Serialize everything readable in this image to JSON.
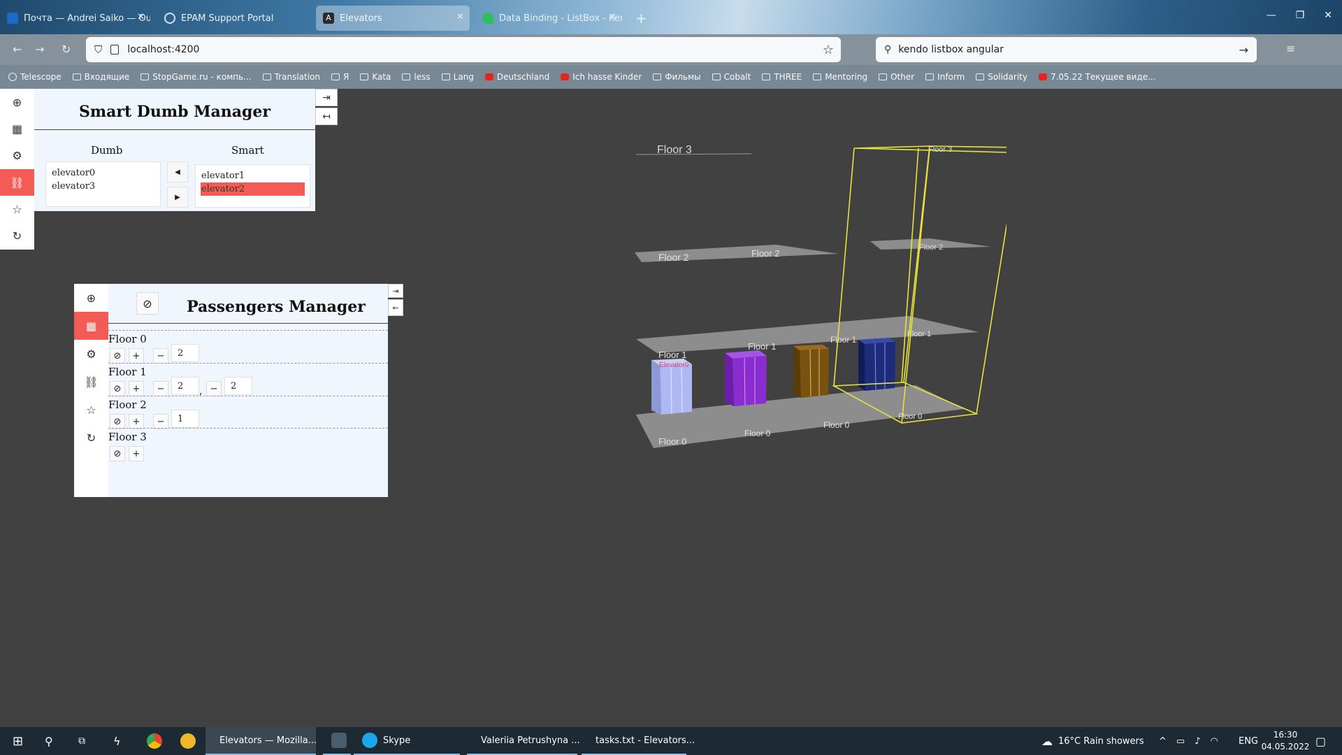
{
  "browser": {
    "tabs": [
      {
        "label": "Почта — Andrei Saiko — Outlo",
        "icon": "outlook-icon"
      },
      {
        "label": "EPAM Support Portal",
        "icon": "portal-icon"
      },
      {
        "label": "Elevators",
        "icon": "angular-icon",
        "active": true
      },
      {
        "label": "Data Binding - ListBox - Kendo",
        "icon": "kendo-icon"
      }
    ],
    "new_tab": "+",
    "url": "localhost:4200",
    "search": "kendo listbox angular",
    "bookmarks": [
      {
        "label": "Telescope",
        "icon": "globe"
      },
      {
        "label": "Входящие",
        "icon": "mail"
      },
      {
        "label": "StopGame.ru - компь...",
        "icon": "game"
      },
      {
        "label": "Translation",
        "icon": "translate"
      },
      {
        "label": "Я",
        "icon": "yandex"
      },
      {
        "label": "Kata",
        "icon": "folder"
      },
      {
        "label": "less",
        "icon": "folder"
      },
      {
        "label": "Lang",
        "icon": "folder"
      },
      {
        "label": "Deutschland",
        "icon": "youtube"
      },
      {
        "label": "Ich hasse Kinder",
        "icon": "youtube"
      },
      {
        "label": "Фильмы",
        "icon": "folder"
      },
      {
        "label": "Cobalt",
        "icon": "folder"
      },
      {
        "label": "THREE",
        "icon": "folder"
      },
      {
        "label": "Mentoring",
        "icon": "folder"
      },
      {
        "label": "Other",
        "icon": "folder"
      },
      {
        "label": "Inform",
        "icon": "folder"
      },
      {
        "label": "Solidarity",
        "icon": "folder"
      },
      {
        "label": "7.05.22 Текущее виде...",
        "icon": "youtube"
      }
    ]
  },
  "smart_dumb_manager": {
    "title": "Smart Dumb Manager",
    "dumb_header": "Dumb",
    "smart_header": "Smart",
    "dumb_items": [
      "elevator0",
      "elevator3"
    ],
    "smart_items": [
      "elevator1",
      "elevator2"
    ],
    "selected_smart": "elevator2",
    "sidebar_active": "link"
  },
  "passengers_manager": {
    "title": "Passengers Manager",
    "sidebar_active": "table",
    "floors": [
      {
        "label": "Floor 0",
        "groups": [
          "2"
        ]
      },
      {
        "label": "Floor 1",
        "groups": [
          "2",
          "2"
        ]
      },
      {
        "label": "Floor 2",
        "groups": [
          "1"
        ]
      },
      {
        "label": "Floor 3",
        "groups": []
      }
    ]
  },
  "scene": {
    "floor_labels": {
      "floor3": "Floor 3",
      "floor2": "Floor 2",
      "floor1": "Floor 1",
      "floor0": "Floor 0",
      "elevator_tag": "Elevator0"
    },
    "colors": {
      "elevator0": "#aeb8f2",
      "elevator1": "#8a2cd0",
      "elevator2": "#7a5210",
      "elevator3": "#1d2b7a",
      "shaft": "#e8e23a",
      "slab": "#8d8d8d"
    }
  },
  "taskbar": {
    "apps": [
      {
        "label": "Elevators — Mozilla...",
        "active": true
      },
      {
        "label": "Skype"
      },
      {
        "label": "Valeriia Petrushyna ..."
      },
      {
        "label": "tasks.txt - Elevators..."
      }
    ],
    "weather": "16°C  Rain showers",
    "lang": "ENG",
    "time": "16:30",
    "date": "04.05.2022"
  }
}
